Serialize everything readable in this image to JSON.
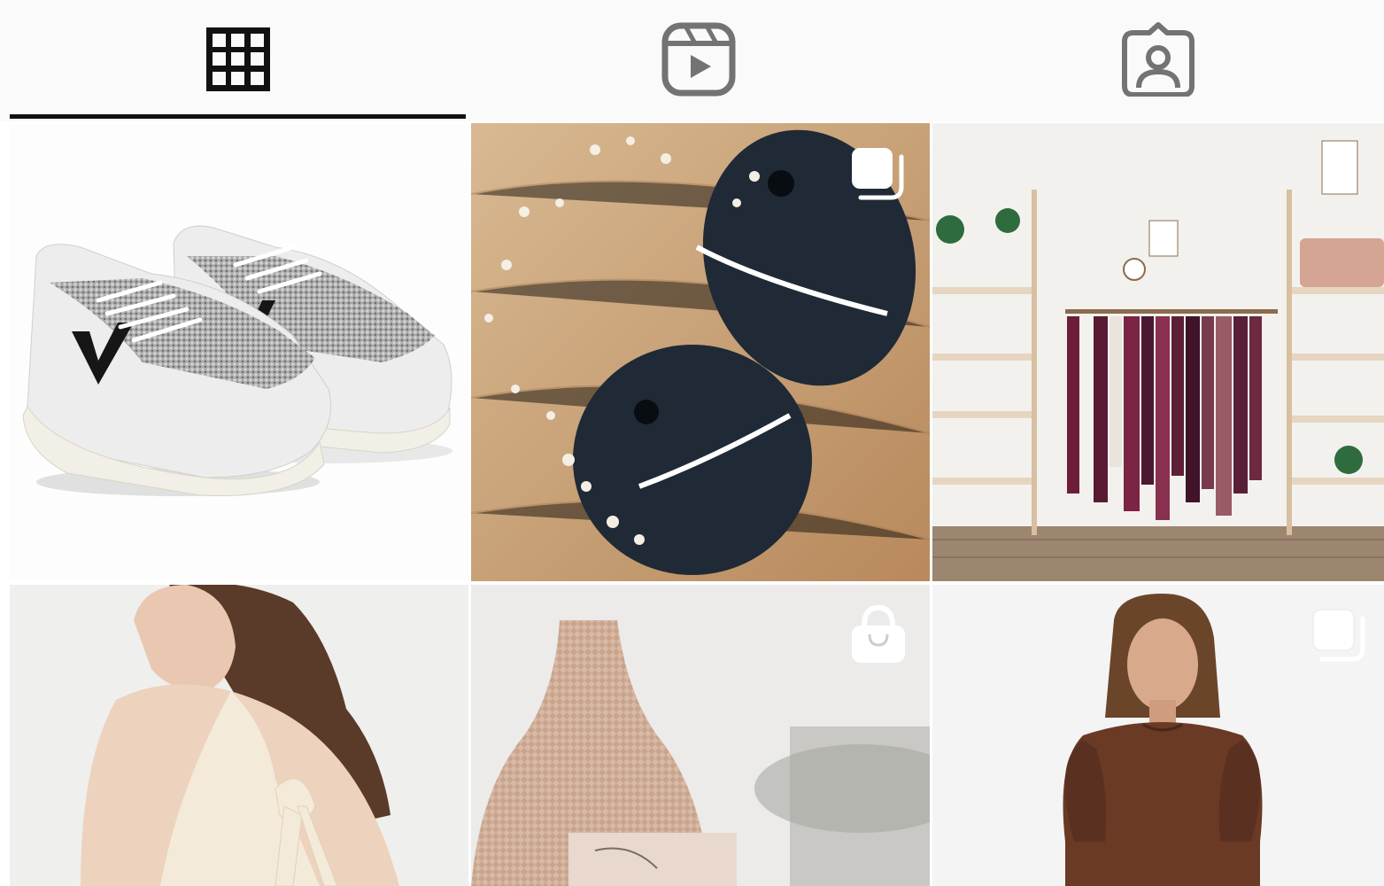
{
  "tabs": [
    {
      "id": "posts",
      "icon": "grid-icon",
      "active": true
    },
    {
      "id": "reels",
      "icon": "reels-icon",
      "active": false
    },
    {
      "id": "tagged",
      "icon": "tagged-icon",
      "active": false
    }
  ],
  "grid": {
    "items": [
      {
        "subject": "sneakers",
        "badge": null
      },
      {
        "subject": "vases",
        "badge": "carousel-icon"
      },
      {
        "subject": "store-interior",
        "badge": null
      },
      {
        "subject": "woman-tie-back-top",
        "badge": null
      },
      {
        "subject": "woven-vase",
        "badge": "shopping-bag-icon"
      },
      {
        "subject": "woman-brown-sweater",
        "badge": "carousel-icon"
      }
    ]
  },
  "colors": {
    "active_tab_icon": "#111111",
    "inactive_tab_icon": "#737373",
    "indicator": "#111111"
  }
}
